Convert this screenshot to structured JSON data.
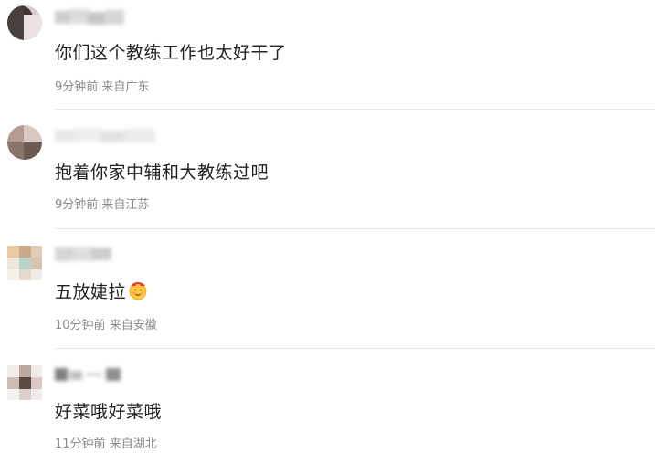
{
  "comments": [
    {
      "text": "你们这个教练工作也太好干了",
      "time": "9分钟前",
      "location": "来自广东"
    },
    {
      "text": "抱着你家中辅和大教练过吧",
      "time": "9分钟前",
      "location": "来自江苏"
    },
    {
      "text": "五放婕拉",
      "emoji": "smiling-face-with-hearts-emoji",
      "time": "10分钟前",
      "location": "来自安徽"
    },
    {
      "text": "好菜哦好菜哦",
      "time": "11分钟前",
      "location": "来自湖北"
    }
  ]
}
